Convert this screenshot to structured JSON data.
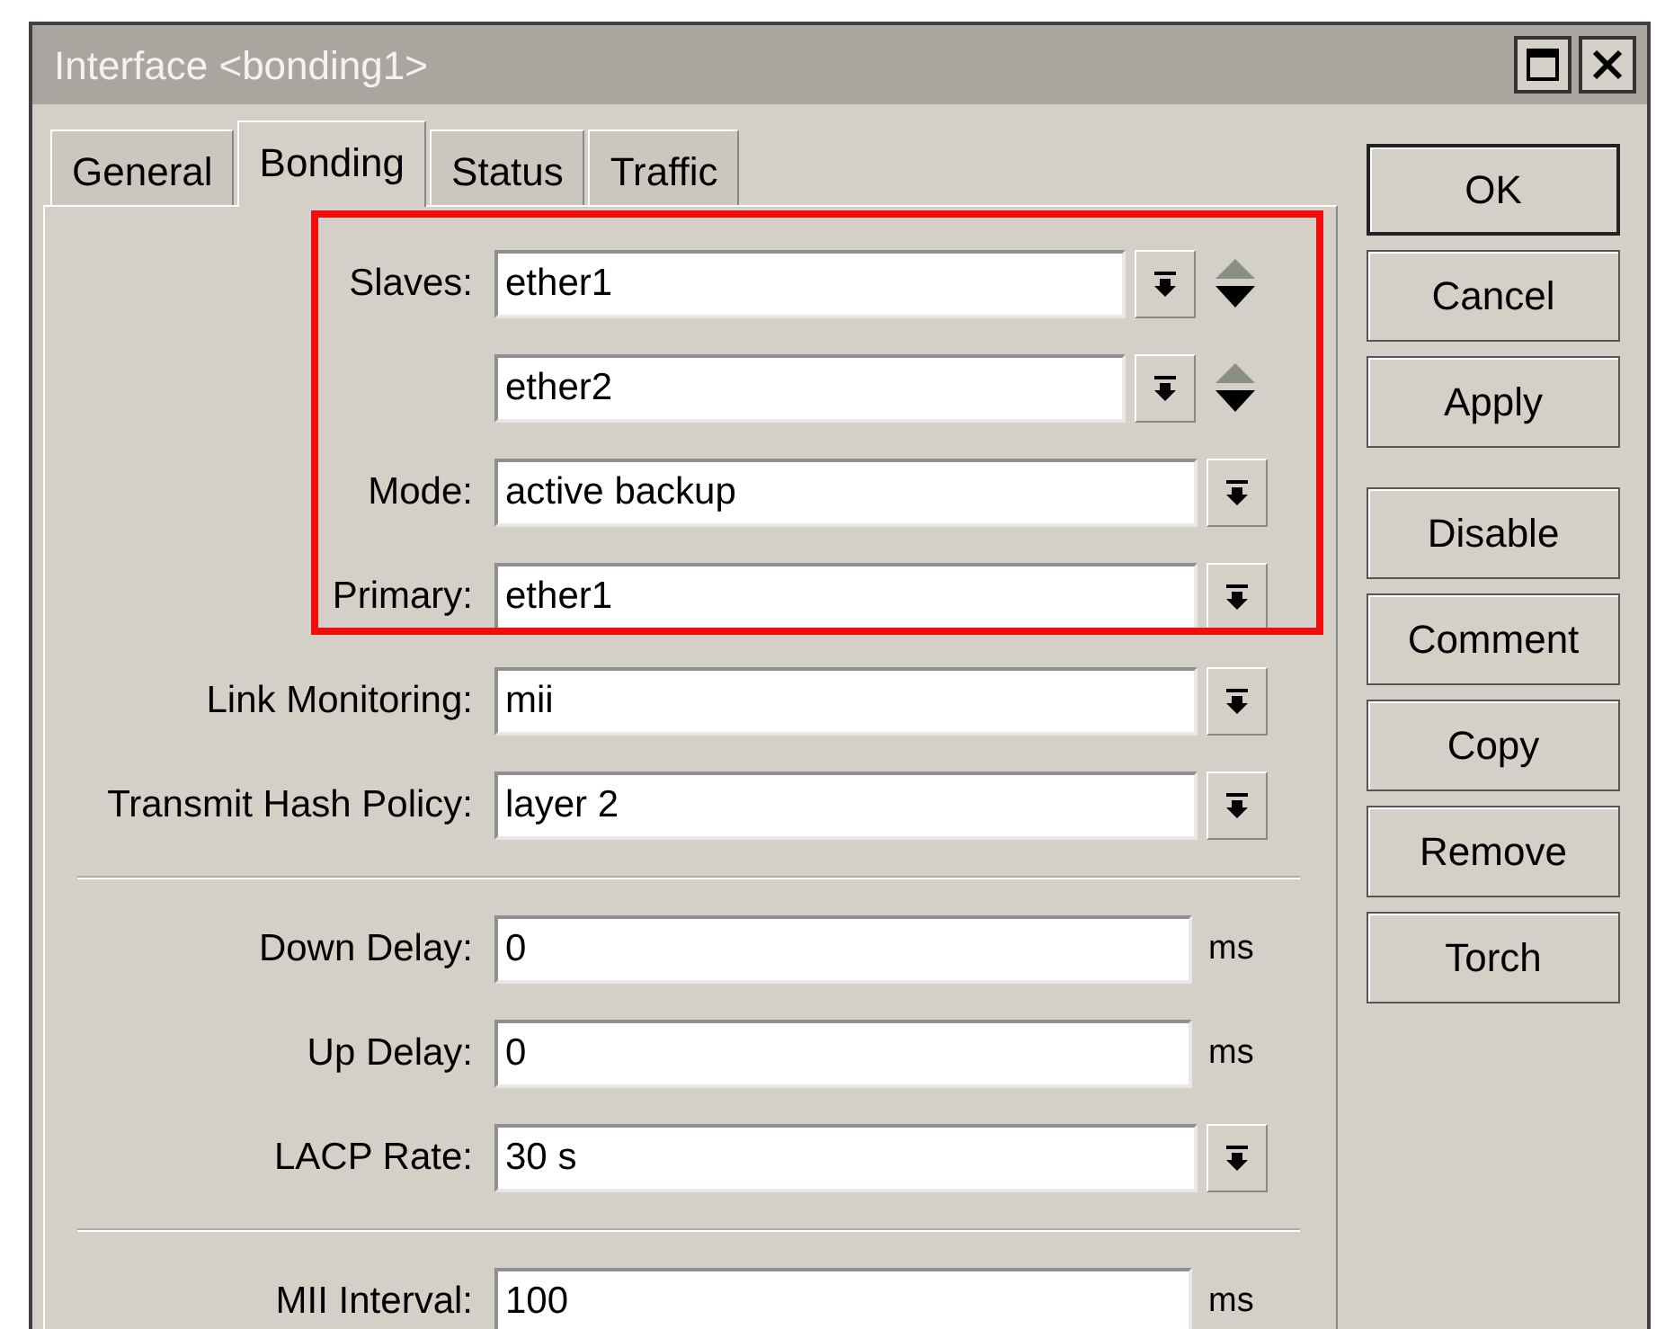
{
  "window": {
    "title": "Interface <bonding1>",
    "controls": [
      {
        "kind": "maximize"
      },
      {
        "kind": "close"
      }
    ]
  },
  "tabs": [
    {
      "label": "General",
      "selected": false
    },
    {
      "label": "Bonding",
      "selected": true
    },
    {
      "label": "Status",
      "selected": false
    },
    {
      "label": "Traffic",
      "selected": false
    }
  ],
  "form": [
    {
      "highlighted": true,
      "divider_above": false,
      "rows": [
        {
          "label": "Slaves:",
          "kind": "multi",
          "value": "ether1"
        },
        {
          "kind": "multi",
          "value": "ether2"
        },
        {
          "label": "Mode:",
          "kind": "select",
          "value": "active backup"
        },
        {
          "label": "Primary:",
          "kind": "select",
          "value": "ether1"
        }
      ]
    },
    {
      "highlighted": false,
      "divider_above": false,
      "rows": [
        {
          "label": "Link Monitoring:",
          "kind": "select",
          "value": "mii"
        },
        {
          "label": "Transmit Hash Policy:",
          "kind": "select",
          "value": "layer 2"
        }
      ]
    },
    {
      "highlighted": false,
      "divider_above": true,
      "rows": [
        {
          "label": "Down Delay:",
          "kind": "text",
          "value": "0",
          "unit": "ms"
        },
        {
          "label": "Up Delay:",
          "kind": "text",
          "value": "0",
          "unit": "ms"
        },
        {
          "label": "LACP Rate:",
          "kind": "select",
          "value": "30 s"
        }
      ]
    },
    {
      "highlighted": false,
      "divider_above": true,
      "rows": [
        {
          "label": "MII Interval:",
          "kind": "text",
          "value": "100",
          "unit": "ms"
        }
      ]
    }
  ],
  "button_groups": [
    [
      {
        "label": "OK",
        "default": true
      },
      {
        "label": "Cancel",
        "default": false
      },
      {
        "label": "Apply",
        "default": false
      }
    ],
    [
      {
        "label": "Disable",
        "default": false
      },
      {
        "label": "Comment",
        "default": false
      },
      {
        "label": "Copy",
        "default": false
      },
      {
        "label": "Remove",
        "default": false
      },
      {
        "label": "Torch",
        "default": false
      }
    ]
  ]
}
